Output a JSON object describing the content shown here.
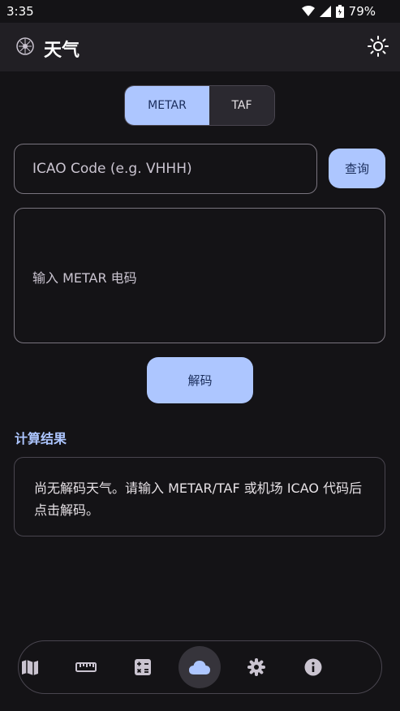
{
  "status": {
    "time": "3:35",
    "battery": "79%"
  },
  "app_bar": {
    "title": "天气"
  },
  "mode": {
    "options": [
      "METAR",
      "TAF"
    ],
    "selected": "METAR"
  },
  "icao": {
    "placeholder": "ICAO Code (e.g. VHHH)",
    "button": "查询"
  },
  "metar": {
    "placeholder": "输入 METAR 电码"
  },
  "decode": {
    "button": "解码"
  },
  "result": {
    "title": "计算结果",
    "message": "尚无解码天气。请输入 METAR/TAF 或机场 ICAO 代码后点击解码。"
  },
  "nav": {
    "items": [
      "map-icon",
      "ruler-icon",
      "calculator-icon",
      "cloud-icon",
      "settings-icon",
      "info-icon"
    ],
    "active": "cloud-icon"
  },
  "colors": {
    "accent": "#adc6ff",
    "background": "#141316",
    "surface": "#211f24"
  }
}
